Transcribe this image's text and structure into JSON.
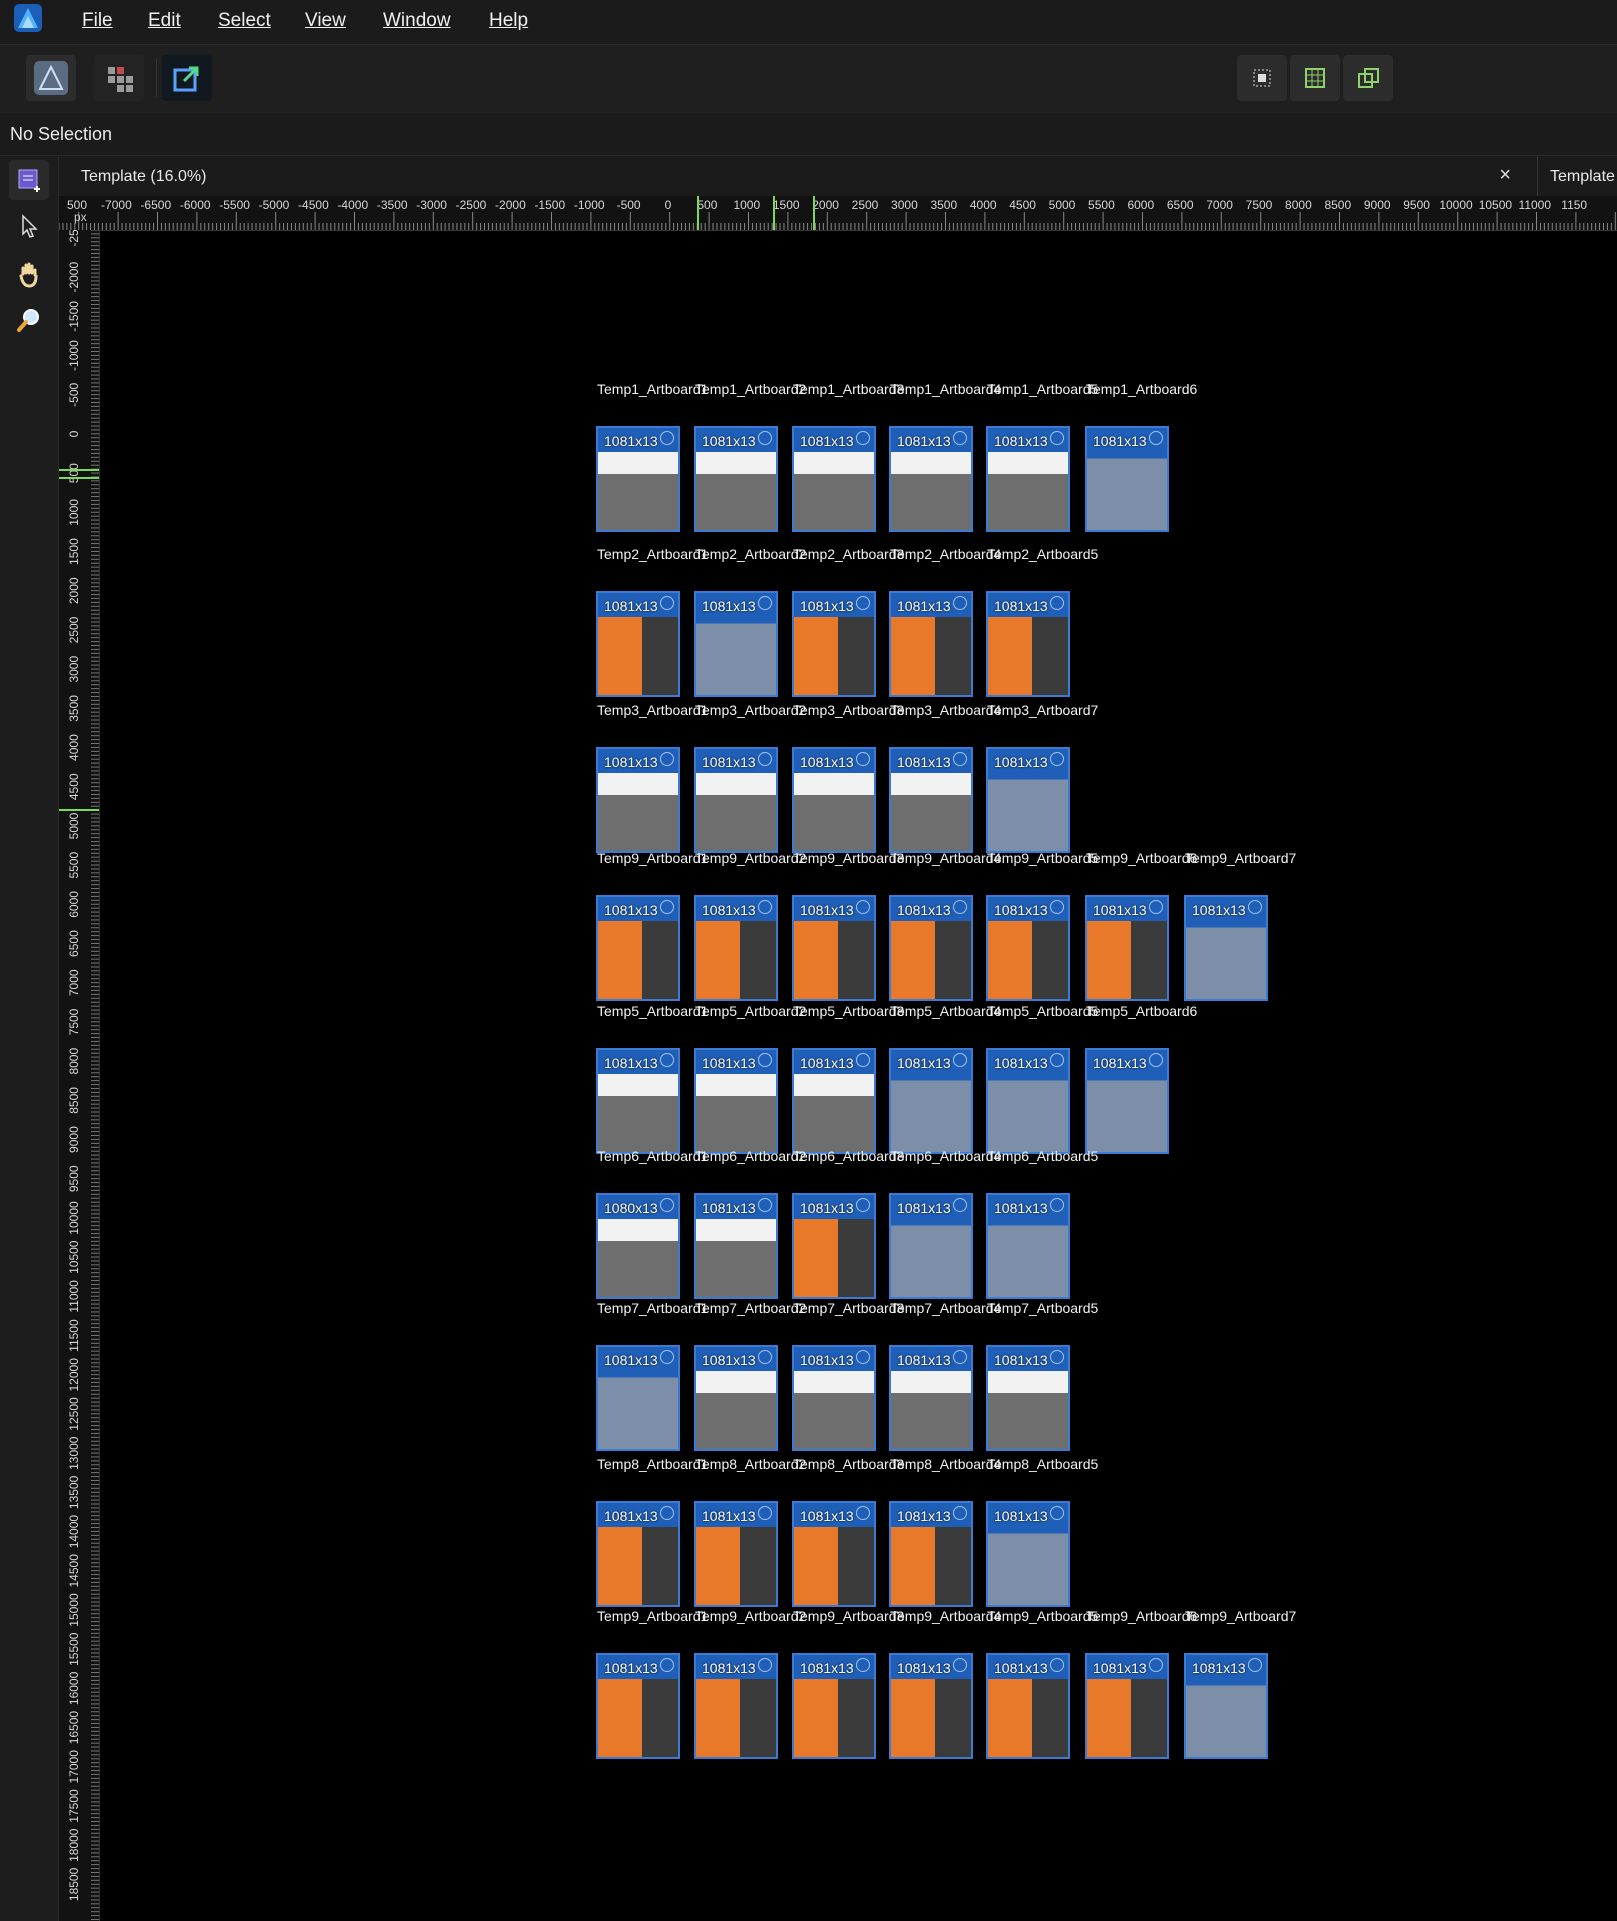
{
  "menubar": {
    "items": [
      {
        "label": "File"
      },
      {
        "label": "Edit"
      },
      {
        "label": "Select"
      },
      {
        "label": "View"
      },
      {
        "label": "Window"
      },
      {
        "label": "Help"
      }
    ]
  },
  "toolbar": {
    "left": [
      "designer-persona-icon",
      "grid-app-icon",
      "export-persona-icon"
    ],
    "right": [
      "snap-icon",
      "grid-snap-icon",
      "transform-icon"
    ]
  },
  "context": {
    "text": "No Selection"
  },
  "tabs": [
    {
      "title": "Template (16.0%)",
      "close": "×"
    },
    {
      "title": "Template"
    }
  ],
  "ruler": {
    "unit": "px",
    "h_ticks": [
      "500",
      "-7000",
      "-6500",
      "-6000",
      "-5500",
      "-5000",
      "-4500",
      "-4000",
      "-3500",
      "-3000",
      "-2500",
      "-2000",
      "-1500",
      "-1000",
      "-500",
      "0",
      "500",
      "1000",
      "1500",
      "2000",
      "2500",
      "3000",
      "3500",
      "4000",
      "4500",
      "5000",
      "5500",
      "6000",
      "6500",
      "7000",
      "7500",
      "8000",
      "8500",
      "9000",
      "9500",
      "10000",
      "10500",
      "11000",
      "1150"
    ],
    "v_ticks": [
      "-25",
      "-2000",
      "-1500",
      "-1000",
      "-500",
      "0",
      "500",
      "1000",
      "1500",
      "2000",
      "2500",
      "3000",
      "3500",
      "4000",
      "4500",
      "5000",
      "5500",
      "6000",
      "6500",
      "7000",
      "7500",
      "8000",
      "8500",
      "9000",
      "9500",
      "10000",
      "10500",
      "11000",
      "11500",
      "12000",
      "12500",
      "13000",
      "13500",
      "14000",
      "14500",
      "15000",
      "15500",
      "16000",
      "16500",
      "17000",
      "17500",
      "18000",
      "18500"
    ]
  },
  "rows": [
    {
      "labels": [
        "Temp1_Artboard1",
        "Temp1_Artboard2",
        "Temp1_Artboard3",
        "Temp1_Artboard4",
        "Temp1_Artboard5",
        "Temp1_Artboard6"
      ],
      "dims": [
        "1081x13",
        "1081x13",
        "1081x13",
        "1081x13",
        "1081x13",
        "1081x13"
      ],
      "themes": [
        "white",
        "white",
        "white",
        "white",
        "white",
        "blue"
      ]
    },
    {
      "labels": [
        "Temp2_Artboard1",
        "Temp2_Artboard2",
        "Temp2_Artboard3",
        "Temp2_Artboard4",
        "Temp2_Artboard5"
      ],
      "dims": [
        "1081x13",
        "1081x13",
        "1081x13",
        "1081x13",
        "1081x13"
      ],
      "themes": [
        "orange",
        "blue",
        "orange",
        "orange",
        "orange"
      ]
    },
    {
      "labels": [
        "Temp3_Artboard1",
        "Temp3_Artboard2",
        "Temp3_Artboard3",
        "Temp3_Artboard4",
        "Temp3_Artboard7"
      ],
      "dims": [
        "1081x13",
        "1081x13",
        "1081x13",
        "1081x13",
        "1081x13"
      ],
      "themes": [
        "white",
        "white",
        "white",
        "white",
        "blue"
      ]
    },
    {
      "labels": [
        "Temp9_Artboard1",
        "Temp9_Artboard2",
        "Temp9_Artboard3",
        "Temp9_Artboard4",
        "Temp9_Artboard5",
        "Temp9_Artboard6",
        "Temp9_Artboard7"
      ],
      "dims": [
        "1081x13",
        "1081x13",
        "1081x13",
        "1081x13",
        "1081x13",
        "1081x13",
        "1081x13"
      ],
      "themes": [
        "orange",
        "orange",
        "orange",
        "orange",
        "orange",
        "orange",
        "blue"
      ]
    },
    {
      "labels": [
        "Temp5_Artboard1",
        "Temp5_Artboard2",
        "Temp5_Artboard3",
        "Temp5_Artboard4",
        "Temp5_Artboard5",
        "Temp5_Artboard6"
      ],
      "dims": [
        "1081x13",
        "1081x13",
        "1081x13",
        "1081x13",
        "1081x13",
        "1081x13"
      ],
      "themes": [
        "white",
        "white",
        "white",
        "blue",
        "blue",
        "blue"
      ]
    },
    {
      "labels": [
        "Temp6_Artboard1",
        "Temp6_Artboard2",
        "Temp6_Artboard3",
        "Temp6_Artboard4",
        "Temp6_Artboard5"
      ],
      "dims": [
        "1080x13",
        "1081x13",
        "1081x13",
        "1081x13",
        "1081x13"
      ],
      "themes": [
        "white",
        "white",
        "orange",
        "blue",
        "blue"
      ]
    },
    {
      "labels": [
        "Temp7_Artboard1",
        "Temp7_Artboard2",
        "Temp7_Artboard3",
        "Temp7_Artboard4",
        "Temp7_Artboard5"
      ],
      "dims": [
        "1081x13",
        "1081x13",
        "1081x13",
        "1081x13",
        "1081x13"
      ],
      "themes": [
        "blue",
        "white",
        "white",
        "white",
        "white"
      ]
    },
    {
      "labels": [
        "Temp8_Artboard1",
        "Temp8_Artboard2",
        "Temp8_Artboard3",
        "Temp8_Artboard4",
        "Temp8_Artboard5"
      ],
      "dims": [
        "1081x13",
        "1081x13",
        "1081x13",
        "1081x13",
        "1081x13"
      ],
      "themes": [
        "orange",
        "orange",
        "orange",
        "orange",
        "blue"
      ]
    },
    {
      "labels": [
        "Temp9_Artboard1",
        "Temp9_Artboard2",
        "Temp9_Artboard3",
        "Temp9_Artboard4",
        "Temp9_Artboard5",
        "Temp9_Artboard6",
        "Temp9_Artboard7"
      ],
      "dims": [
        "1081x13",
        "1081x13",
        "1081x13",
        "1081x13",
        "1081x13",
        "1081x13",
        "1081x13"
      ],
      "themes": [
        "orange",
        "orange",
        "orange",
        "orange",
        "orange",
        "orange",
        "blue"
      ]
    }
  ],
  "colors": {
    "artboard_border": "#3a7bd5",
    "orange": "#e8782a",
    "blue": "#1f5fb8",
    "white": "#f2f2f2",
    "canvas": "#000000"
  }
}
